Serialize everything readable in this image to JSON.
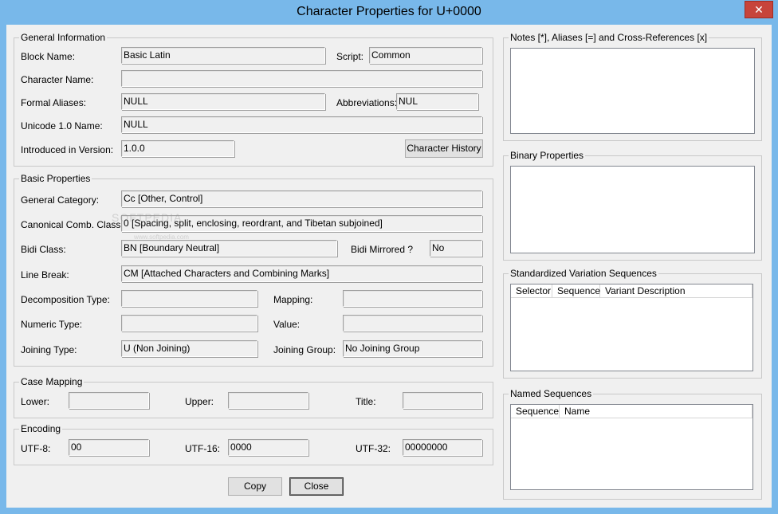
{
  "window": {
    "title": "Character Properties for U+0000",
    "close_glyph": "✕"
  },
  "general": {
    "title": "General Information",
    "block_name_label": "Block Name:",
    "block_name": "Basic Latin",
    "script_label": "Script:",
    "script": "Common",
    "character_name_label": "Character Name:",
    "character_name": "",
    "formal_aliases_label": "Formal Aliases:",
    "formal_aliases": "NULL",
    "abbreviations_label": "Abbreviations:",
    "abbreviations": "NUL",
    "unicode1_label": "Unicode 1.0 Name:",
    "unicode1": "NULL",
    "introduced_label": "Introduced in Version:",
    "introduced": "1.0.0",
    "history_button": "Character History"
  },
  "basic": {
    "title": "Basic Properties",
    "general_category_label": "General Category:",
    "general_category": "Cc [Other, Control]",
    "canonical_label": "Canonical Comb. Class:",
    "canonical": "0 [Spacing, split, enclosing, reordrant, and Tibetan subjoined]",
    "bidi_class_label": "Bidi Class:",
    "bidi_class": "BN [Boundary Neutral]",
    "bidi_mirrored_label": "Bidi Mirrored ?",
    "bidi_mirrored": "No",
    "line_break_label": "Line Break:",
    "line_break": "CM [Attached Characters and Combining Marks]",
    "decomposition_label": "Decomposition Type:",
    "decomposition": "",
    "mapping_label": "Mapping:",
    "mapping": "",
    "numeric_label": "Numeric Type:",
    "numeric": "",
    "value_label": "Value:",
    "value": "",
    "joining_type_label": "Joining Type:",
    "joining_type": "U (Non Joining)",
    "joining_group_label": "Joining Group:",
    "joining_group": "No Joining Group"
  },
  "case": {
    "title": "Case Mapping",
    "lower_label": "Lower:",
    "lower": "",
    "upper_label": "Upper:",
    "upper": "",
    "title_label": "Title:",
    "title_value": ""
  },
  "encoding": {
    "title": "Encoding",
    "utf8_label": "UTF-8:",
    "utf8": "00",
    "utf16_label": "UTF-16:",
    "utf16": "0000",
    "utf32_label": "UTF-32:",
    "utf32": "00000000"
  },
  "buttons": {
    "copy": "Copy",
    "close": "Close"
  },
  "notes": {
    "title": "Notes [*], Aliases [=] and Cross-References [x]"
  },
  "binary": {
    "title": "Binary Properties"
  },
  "variation": {
    "title": "Standardized Variation Sequences",
    "columns": [
      "Selector",
      "Sequence",
      "Variant Description"
    ]
  },
  "named": {
    "title": "Named Sequences",
    "columns": [
      "Sequence",
      "Name"
    ]
  },
  "watermark": {
    "line1": "SOFTPEDIA",
    "line2": "www.softpedia.com"
  }
}
